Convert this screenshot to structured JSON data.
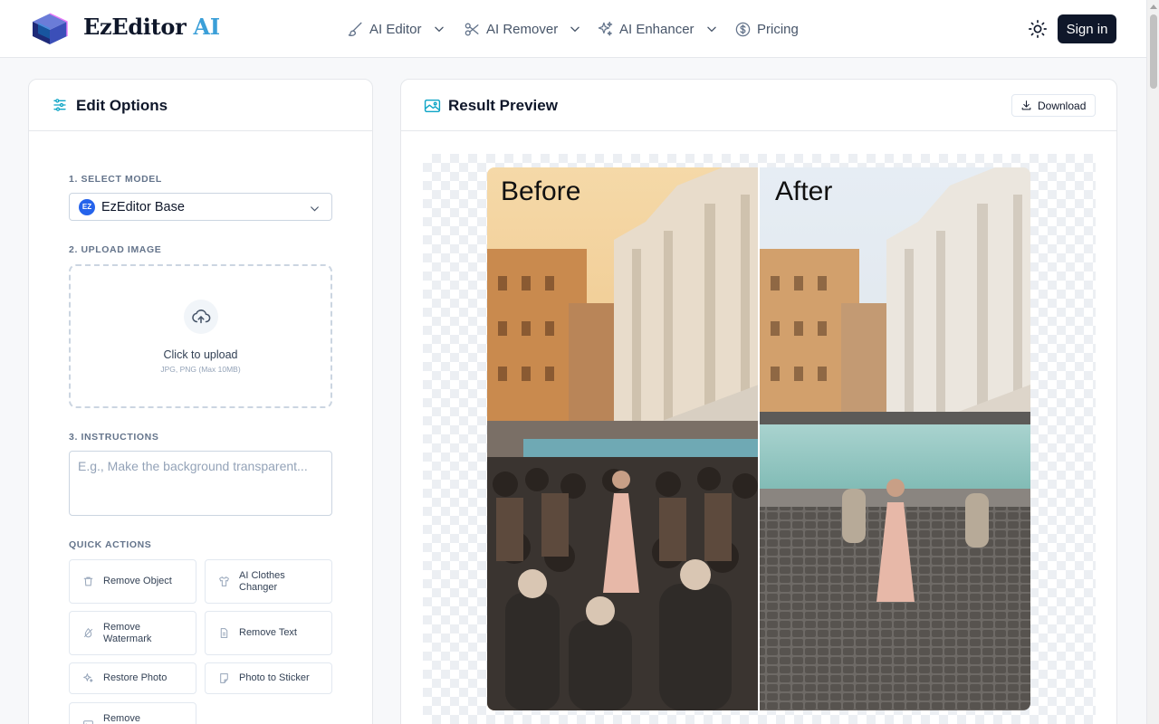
{
  "header": {
    "brand_name": "EzEditor",
    "brand_suffix": "AI",
    "nav": [
      {
        "label": "AI Editor",
        "icon": "brush-icon",
        "dropdown": true
      },
      {
        "label": "AI Remover",
        "icon": "scissors-icon",
        "dropdown": true
      },
      {
        "label": "AI Enhancer",
        "icon": "sparkles-icon",
        "dropdown": true
      },
      {
        "label": "Pricing",
        "icon": "dollar-circle-icon",
        "dropdown": false
      }
    ],
    "theme_icon": "sun-icon",
    "signin_label": "Sign in"
  },
  "edit_options": {
    "title": "Edit Options",
    "icon": "sliders-icon",
    "model": {
      "label": "1. SELECT MODEL",
      "badge": "EZ",
      "selected": "EzEditor Base"
    },
    "upload": {
      "label": "2. UPLOAD IMAGE",
      "icon": "cloud-upload-icon",
      "title": "Click to upload",
      "hint": "JPG, PNG (Max 10MB)"
    },
    "instructions": {
      "label": "3. INSTRUCTIONS",
      "placeholder": "E.g., Make the background transparent...",
      "value": ""
    },
    "quick_actions": {
      "label": "QUICK ACTIONS",
      "items": [
        {
          "label": "Remove Object",
          "icon": "trash-icon"
        },
        {
          "label": "AI Clothes Changer",
          "icon": "shirt-icon"
        },
        {
          "label": "Remove Watermark",
          "icon": "droplet-icon"
        },
        {
          "label": "Remove Text",
          "icon": "document-icon"
        },
        {
          "label": "Restore Photo",
          "icon": "sparkles-icon"
        },
        {
          "label": "Photo to Sticker",
          "icon": "sticker-icon"
        },
        {
          "label": "Remove",
          "icon": "image-icon"
        }
      ]
    }
  },
  "result_preview": {
    "title": "Result Preview",
    "icon": "image-icon",
    "download_label": "Download",
    "before_label": "Before",
    "after_label": "After"
  },
  "colors": {
    "accent": "#3b9fd8",
    "primary_dark": "#0f172a",
    "muted_text": "#64748b",
    "border": "#e5e7eb"
  }
}
